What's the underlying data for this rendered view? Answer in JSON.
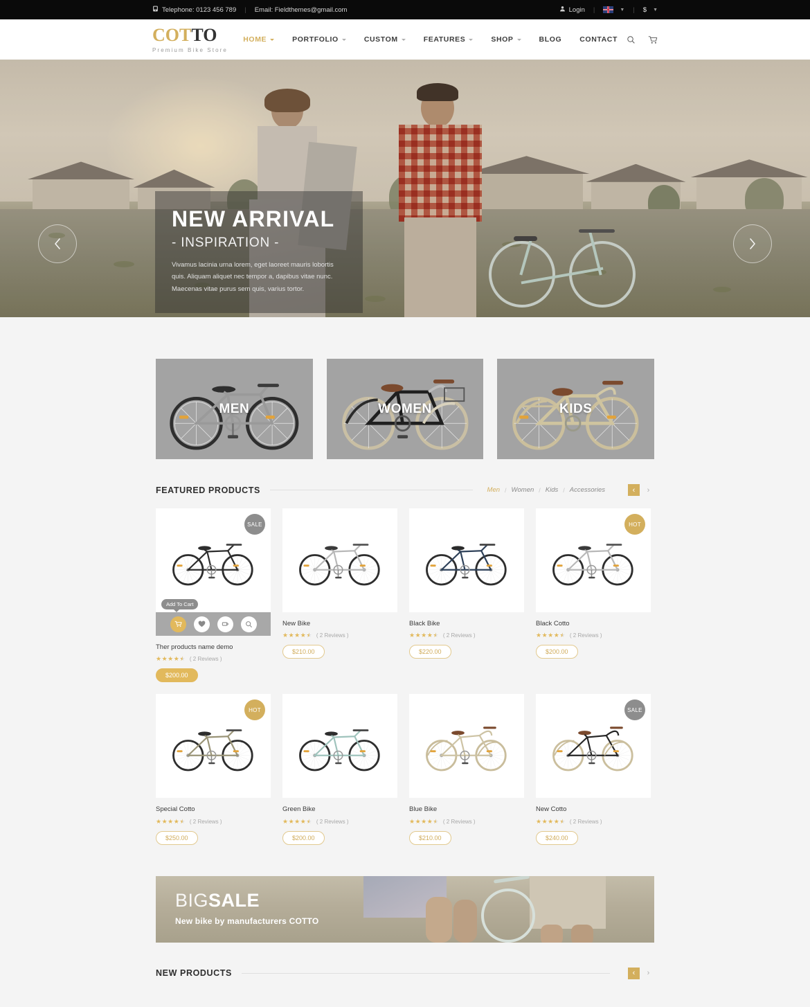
{
  "topbar": {
    "phone_icon": "phone-icon",
    "phone_label": "Telephone: 0123 456 789",
    "email_label": "Email: Fieldthemes@gmail.com",
    "user_icon": "user-icon",
    "login_label": "Login",
    "flag_icon": "uk-flag-icon",
    "currency_label": "$"
  },
  "header": {
    "logo_gold": "COT",
    "logo_dark": "TO",
    "logo_tagline": "Premium Bike Store",
    "nav": [
      {
        "label": "HOME",
        "caret": true,
        "active": true
      },
      {
        "label": "PORTFOLIO",
        "caret": true,
        "active": false
      },
      {
        "label": "CUSTOM",
        "caret": true,
        "active": false
      },
      {
        "label": "FEATURES",
        "caret": true,
        "active": false
      },
      {
        "label": "SHOP",
        "caret": true,
        "active": false
      },
      {
        "label": "BLOG",
        "caret": false,
        "active": false
      },
      {
        "label": "CONTACT",
        "caret": false,
        "active": false
      }
    ],
    "search_icon": "search-icon",
    "cart_icon": "cart-icon"
  },
  "hero": {
    "title": "NEW ARRIVAL",
    "subtitle": "- INSPIRATION -",
    "body": "Vivamus lacinia urna lorem, eget laoreet mauris lobortis quis. Aliquam aliquet nec tempor a, dapibus vitae nunc. Maecenas vitae purus sem quis, varius tortor.",
    "prev_icon": "chevron-left-icon",
    "next_icon": "chevron-right-icon"
  },
  "categories": [
    {
      "label": "MEN"
    },
    {
      "label": "WOMEN"
    },
    {
      "label": "KIDS"
    }
  ],
  "featured": {
    "title": "FEATURED PRODUCTS",
    "filters": [
      {
        "label": "Men",
        "active": true
      },
      {
        "label": "Women",
        "active": false
      },
      {
        "label": "Kids",
        "active": false
      },
      {
        "label": "Accessories",
        "active": false
      }
    ],
    "prev_icon": "chevron-left-icon",
    "next_icon": "chevron-right-icon",
    "hover": {
      "tooltip": "Add To Cart",
      "cart_icon": "cart-icon",
      "wishlist_icon": "heart-icon",
      "compare_icon": "compare-icon",
      "quickview_icon": "magnifier-icon"
    },
    "products": [
      {
        "name": "Ther products name demo",
        "price": "$200.00",
        "reviews": "( 2 Reviews )",
        "rating": 4.5,
        "badge": "SALE",
        "badge_type": "sale",
        "hovered": true,
        "bike": "black-road"
      },
      {
        "name": "New Bike",
        "price": "$210.00",
        "reviews": "( 2 Reviews )",
        "rating": 4.5,
        "badge": null,
        "badge_type": null,
        "hovered": false,
        "bike": "silver-road"
      },
      {
        "name": "Black Bike",
        "price": "$220.00",
        "reviews": "( 2 Reviews )",
        "rating": 4.5,
        "badge": null,
        "badge_type": null,
        "hovered": false,
        "bike": "navy-road"
      },
      {
        "name": "Black Cotto",
        "price": "$200.00",
        "reviews": "( 2 Reviews )",
        "rating": 4.5,
        "badge": "HOT",
        "badge_type": "hot",
        "hovered": false,
        "bike": "silver-road"
      },
      {
        "name": "Special Cotto",
        "price": "$250.00",
        "reviews": "( 2 Reviews )",
        "rating": 4.5,
        "badge": "HOT",
        "badge_type": "hot",
        "hovered": false,
        "bike": "olive-road"
      },
      {
        "name": "Green Bike",
        "price": "$200.00",
        "reviews": "( 2 Reviews )",
        "rating": 4.5,
        "badge": null,
        "badge_type": null,
        "hovered": false,
        "bike": "mint-road"
      },
      {
        "name": "Blue Bike",
        "price": "$210.00",
        "reviews": "( 2 Reviews )",
        "rating": 4.5,
        "badge": null,
        "badge_type": null,
        "hovered": false,
        "bike": "cream-dutch"
      },
      {
        "name": "New Cotto",
        "price": "$240.00",
        "reviews": "( 2 Reviews )",
        "rating": 4.5,
        "badge": "SALE",
        "badge_type": "sale",
        "hovered": false,
        "bike": "black-dutch"
      }
    ]
  },
  "banner": {
    "big_thin": "BIG",
    "big_bold": "SALE",
    "subtitle": "New bike by  manufacturers COTTO"
  },
  "new_products": {
    "title": "NEW PRODUCTS",
    "prev_icon": "chevron-left-icon",
    "next_icon": "chevron-right-icon"
  },
  "colors": {
    "gold": "#d3af5d",
    "dark": "#0a0a0a",
    "page_bg": "#f4f4f4",
    "badge_sale": "#8d8d8d",
    "badge_hot": "#d3af5d"
  }
}
